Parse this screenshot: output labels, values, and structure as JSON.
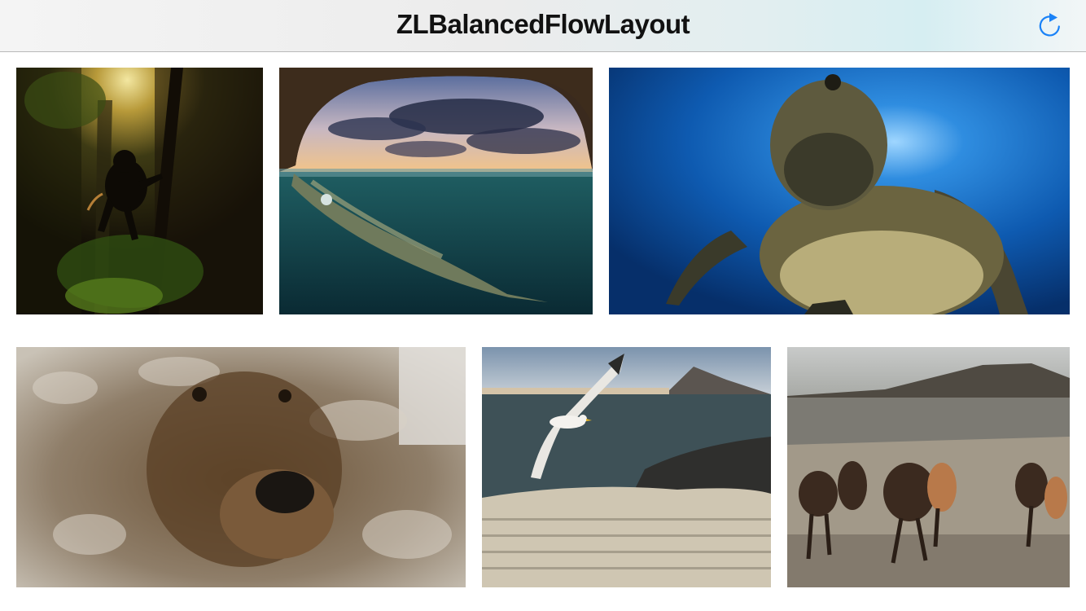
{
  "navbar": {
    "title": "ZLBalancedFlowLayout",
    "refresh_icon": "refresh-icon",
    "tint_color": "#1a82f7"
  },
  "gallery": {
    "photos": [
      {
        "subject": "monkey-in-forest"
      },
      {
        "subject": "iguana-underwater"
      },
      {
        "subject": "sea-turtle"
      },
      {
        "subject": "frosted-bear"
      },
      {
        "subject": "seagull-over-colony"
      },
      {
        "subject": "running-horses"
      }
    ]
  }
}
